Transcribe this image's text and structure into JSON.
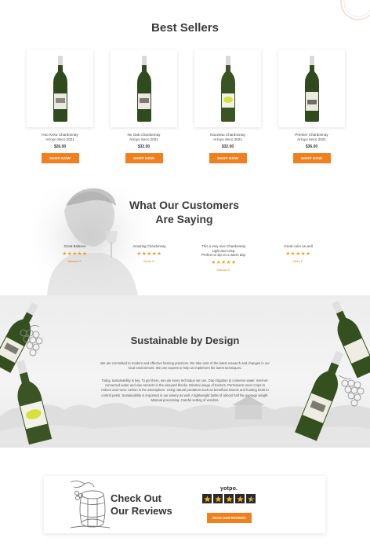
{
  "colors": {
    "accent": "#f07f1e",
    "star": "#f29a20",
    "heading": "#3a3a3a"
  },
  "best_sellers": {
    "title": "Best Sellers",
    "products": [
      {
        "name_line1": "Hoo Krew Chardonnay",
        "name_line2": "Arroyo Seco 2021",
        "price": "$26.00",
        "button": "SHOP NOW",
        "label": "plain"
      },
      {
        "name_line1": "No Oak Chardonnay",
        "name_line2": "Arroyo Seco 2021",
        "price": "$32.00",
        "button": "SHOP NOW",
        "label": "plain"
      },
      {
        "name_line1": "Nouveau Chardonnay",
        "name_line2": "Arroyo Seco 2021",
        "price": "$32.00",
        "button": "SHOP NOW",
        "label": "green"
      },
      {
        "name_line1": "Premier Chardonnay",
        "name_line2": "Arroyo Seco 2021",
        "price": "$36.00",
        "button": "SHOP NOW",
        "label": "plain"
      }
    ]
  },
  "testimonials": {
    "title_line1": "What Our Customers",
    "title_line2": "Are Saying",
    "items": [
      {
        "lines": [
          "Great Balance"
        ],
        "stars": "★★★★★",
        "author": "Samson F."
      },
      {
        "lines": [
          "Amazing Chardonnay"
        ],
        "stars": "★★★★★",
        "author": "Kevin S."
      },
      {
        "lines": [
          "This a very nice Chardonnay.",
          "Light and crisp.",
          "Perfect to sip on a warm day."
        ],
        "stars": "★★★★★",
        "author": "Michael C."
      },
      {
        "lines": [
          "Great color as well"
        ],
        "stars": "★★★★★",
        "author": "Mark P."
      }
    ]
  },
  "sustainable": {
    "title": "Sustainable by Design",
    "para1": "We are committed to modern and effective farming practices. We take note of the latest research and changes in our local environment. We use experts to help us implement the latest techniques.",
    "para2": "Today, sustainability is key. To get there, we use every technique we can. Drip irrigation to conserve water. Internet-connected water and vine sensors in the vineyard blocks. Minimal usage of tractors. Permanent cover crops to reduce and move carbon in the atmosphere. Using natural predators such as beneficial insects and hunting birds to control pests. Sustainability is important in our winery as well. A lightweight bottle of almost half the average weight. Minimal processing. Careful vetting of vendors."
  },
  "reviews_cta": {
    "title_line1": "Check Out",
    "title_line2": "Our Reviews",
    "brand": "yotpo.",
    "stars": 4.5,
    "button": "READ OUR REVIEWS"
  }
}
